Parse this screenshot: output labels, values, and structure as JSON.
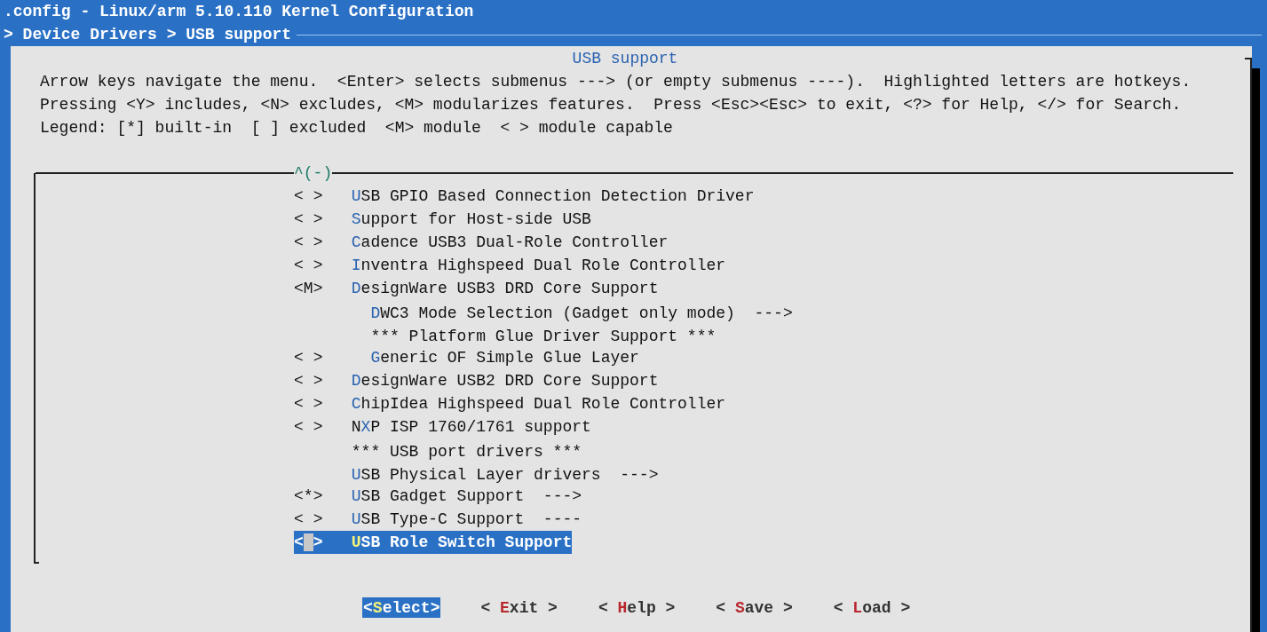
{
  "title_bar": {
    "title": ".config - Linux/arm 5.10.110 Kernel Configuration"
  },
  "breadcrumb": {
    "text": "> Device Drivers > USB support"
  },
  "dialog": {
    "title": "USB support",
    "help_lines": [
      "Arrow keys navigate the menu.  <Enter> selects submenus ---> (or empty submenus ----).  Highlighted letters are hotkeys.",
      "Pressing <Y> includes, <N> excludes, <M> modularizes features.  Press <Esc><Esc> to exit, <?> for Help, </> for Search.",
      "Legend: [*] built-in  [ ] excluded  <M> module  < > module capable"
    ],
    "menu": {
      "scroll_indicator": "^(-)",
      "items": [
        {
          "state": "< >",
          "hotkey": "U",
          "rest": "SB GPIO Based Connection Detection Driver",
          "selected": false
        },
        {
          "state": "< >",
          "hotkey": "S",
          "rest": "upport for Host-side USB",
          "selected": false
        },
        {
          "state": "< >",
          "hotkey": "C",
          "rest": "adence USB3 Dual-Role Controller",
          "selected": false
        },
        {
          "state": "< >",
          "hotkey": "I",
          "rest": "nventra Highspeed Dual Role Controller",
          "selected": false
        },
        {
          "state": "<M>",
          "hotkey": "D",
          "rest": "esignWare USB3 DRD Core Support",
          "selected": false,
          "children": [
            {
              "hotkey": "D",
              "rest": "WC3 Mode Selection (Gadget only mode)  --->",
              "selected": false
            },
            {
              "rest": "*** Platform Glue Driver Support ***",
              "selected": false
            },
            {
              "state": "< >",
              "hotkey": "G",
              "rest": "eneric OF Simple Glue Layer",
              "selected": false
            }
          ]
        },
        {
          "state": "< >",
          "hotkey": "D",
          "rest": "esignWare USB2 DRD Core Support",
          "selected": false
        },
        {
          "state": "< >",
          "hotkey": "C",
          "rest": "hipIdea Highspeed Dual Role Controller",
          "selected": false
        },
        {
          "state": "< >",
          "lead": "N",
          "hotkey": "X",
          "rest": "P ISP 1760/1761 support",
          "selected": false
        },
        {
          "rest": "*** USB port drivers ***",
          "selected": false
        },
        {
          "hotkey": "U",
          "rest": "SB Physical Layer drivers  --->",
          "selected": false
        },
        {
          "state": "<*>",
          "hotkey": "U",
          "rest": "SB Gadget Support  --->",
          "selected": false
        },
        {
          "state": "< >",
          "hotkey": "U",
          "rest": "SB Type-C Support  ----",
          "selected": false
        },
        {
          "state": "< >",
          "hotkey": "U",
          "rest": "SB Role Switch Support",
          "selected": true
        }
      ]
    },
    "buttons": [
      {
        "lead": "<",
        "hotkey": "S",
        "rest": "elect>",
        "selected": true
      },
      {
        "lead": "< ",
        "hotkey": "E",
        "rest": "xit >",
        "selected": false
      },
      {
        "lead": "< ",
        "hotkey": "H",
        "rest": "elp >",
        "selected": false
      },
      {
        "lead": "< ",
        "hotkey": "S",
        "rest": "ave >",
        "selected": false
      },
      {
        "lead": "< ",
        "hotkey": "L",
        "rest": "oad >",
        "selected": false
      }
    ]
  }
}
